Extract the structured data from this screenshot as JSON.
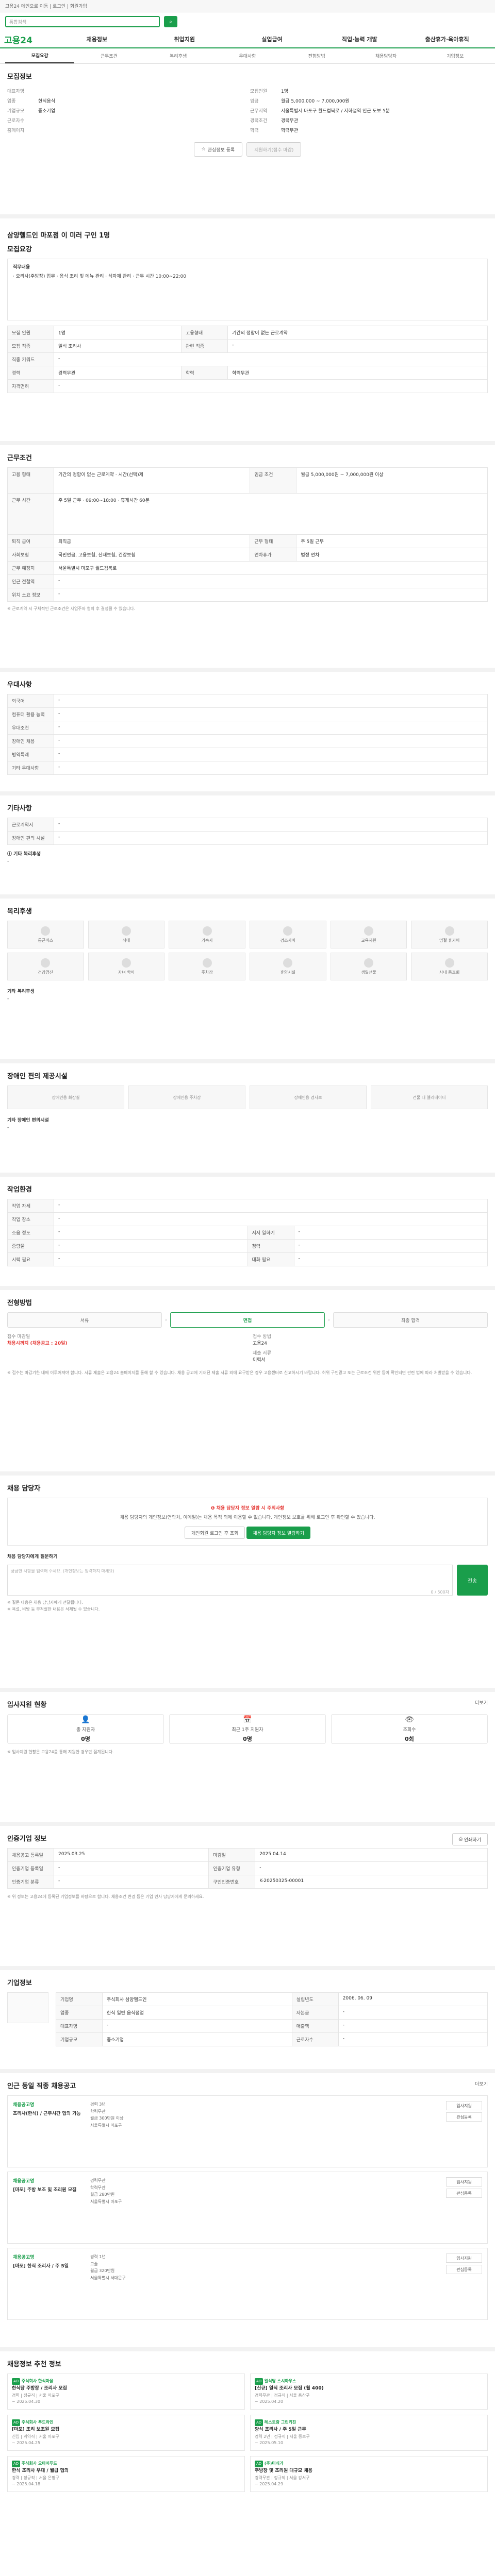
{
  "topbar": {
    "text": "고용24 메인으로 이동 | 로그인 | 회원가입"
  },
  "search": {
    "placeholder": "통합검색"
  },
  "gnb": {
    "logo": "고용24",
    "items": [
      "채용정보",
      "취업지원",
      "실업급여",
      "직업·능력 개발",
      "출산휴가·육아휴직"
    ]
  },
  "tabs": [
    "모집요강",
    "근무조건",
    "복리후생",
    "우대사항",
    "전형방법",
    "채용담당자",
    "기업정보"
  ],
  "company": {
    "title": "모집정보",
    "left": [
      {
        "k": "대표자명",
        "v": ""
      },
      {
        "k": "업종",
        "v": "한식음식"
      },
      {
        "k": "기업규모",
        "v": "중소기업"
      },
      {
        "k": "근로자수",
        "v": ""
      },
      {
        "k": "홈페이지",
        "v": ""
      }
    ],
    "right": [
      {
        "k": "모집인원",
        "v": "1명"
      },
      {
        "k": "임금",
        "v": "월급 5,000,000 ~ 7,000,000원"
      },
      {
        "k": "근무지역",
        "v": "서울특별시 마포구 월드컵북로 / 지하철역 인근 도보 5분"
      },
      {
        "k": "경력조건",
        "v": "경력무관"
      },
      {
        "k": "학력",
        "v": "학력무관"
      }
    ],
    "scrap_label": "관심정보 등록",
    "apply_label": "지원하기(접수 마감)"
  },
  "job": {
    "heading": "삼양헬드인 마포점 이 미러 구인 1명",
    "section_title": "모집요강",
    "desc_title": "직무내용",
    "desc": "· 요리사(주방장) 업무 · 음식 조리 및 메뉴 관리 · 식자재 관리 · 근무 시간 10:00~22:00",
    "table": [
      {
        "k": "모집 인원",
        "v": "1명",
        "k2": "고용형태",
        "v2": "기간의 정함이 없는 근로계약"
      },
      {
        "k": "모집 직종",
        "v": "일식 조리사",
        "k2": "관련 직종",
        "v2": "-"
      },
      {
        "k": "직종 키워드",
        "v": "-",
        "k2": "",
        "v2": ""
      },
      {
        "k": "경력",
        "v": "경력무관",
        "k2": "학력",
        "v2": "학력무관"
      },
      {
        "k": "자격면허",
        "v": "-",
        "k2": "",
        "v2": ""
      }
    ]
  },
  "conditions": {
    "title": "근무조건",
    "table": [
      {
        "k": "고용 형태",
        "v": "기간의 정함이 없는 근로계약 · 시간(선택)제",
        "k2": "임금 조건",
        "v2": "월급 5,000,000원 ~ 7,000,000원 이상"
      },
      {
        "k": "근무 시간",
        "v": "주 5일 근무 · 09:00~18:00 · 휴게시간 60분",
        "k2": "",
        "v2": ""
      },
      {
        "k": "퇴직 급여",
        "v": "퇴직금",
        "k2": "근무 형태",
        "v2": "주 5일 근무"
      },
      {
        "k": "사회보험",
        "v": "국민연금, 고용보험, 산재보험, 건강보험",
        "k2": "연차휴가",
        "v2": "법정 연차"
      },
      {
        "k": "근무 예정지",
        "v": "서울특별시 마포구 월드컵북로",
        "k2": "",
        "v2": ""
      },
      {
        "k": "인근 전철역",
        "v": "-",
        "k2": "",
        "v2": ""
      },
      {
        "k": "위치 소요 정보",
        "v": "-",
        "k2": "",
        "v2": ""
      }
    ],
    "note": "※ 근로계약 시 구체적인 근로조건은 사업주와 협의 후 결정될 수 있습니다."
  },
  "prefer": {
    "title": "우대사항",
    "rows": [
      {
        "k": "외국어",
        "v": "-"
      },
      {
        "k": "컴퓨터 활용 능력",
        "v": "-"
      },
      {
        "k": "우대조건",
        "v": "-"
      },
      {
        "k": "장애인 채용",
        "v": "-"
      },
      {
        "k": "병역특례",
        "v": "-"
      },
      {
        "k": "기타 우대사항",
        "v": "-"
      }
    ]
  },
  "etc": {
    "title": "기타사항",
    "rows": [
      {
        "k": "근로계약서",
        "v": "-"
      },
      {
        "k": "장애인 편의 시설",
        "v": "-"
      }
    ],
    "sub_title": "ⓘ 기타 복리후생",
    "sub_val": "-"
  },
  "welfare": {
    "title": "복리후생",
    "cards": [
      "통근버스",
      "식대",
      "기숙사",
      "경조사비",
      "교육지원",
      "명절 휴가비",
      "건강검진",
      "자녀 학비",
      "주차장",
      "휴양시설",
      "생일선물",
      "사내 동호회"
    ],
    "sub_title": "기타 복리후생",
    "sub_val": "-"
  },
  "disabled": {
    "title": "장애인 편의 제공시설",
    "cards": [
      "장애인용 화장실",
      "장애인용 주차장",
      "장애인용 경사로",
      "건물 내 엘리베이터"
    ],
    "sub_title": "기타 장애인 편의시설",
    "sub_val": "-"
  },
  "workenv": {
    "title": "작업환경",
    "rows": [
      {
        "k": "작업 자세",
        "v": "-",
        "k2": "",
        "v2": ""
      },
      {
        "k": "작업 장소",
        "v": "-",
        "k2": "",
        "v2": ""
      },
      {
        "k": "소음 정도",
        "v": "-",
        "k2": "서서 일하기",
        "v2": "-"
      },
      {
        "k": "중량물",
        "v": "-",
        "k2": "청력",
        "v2": "-"
      },
      {
        "k": "시력 필요",
        "v": "-",
        "k2": "대화 필요",
        "v2": "-"
      }
    ]
  },
  "selection": {
    "title": "전형방법",
    "steps": [
      "서류",
      "면접",
      "최종 합격"
    ],
    "deadline_k": "접수 마감일",
    "deadline_v": "채용시까지 (채용공고 : 20일)",
    "method_k": "접수 방법",
    "method_v": "고용24",
    "docs_k": "제출 서류",
    "docs_v": "이력서",
    "notice": "※ 접수는 마감기한 내에 이루어져야 합니다. 서류 제출은 고용24 홈페이지를 통해 할 수 있습니다. 채용 공고에 기재된 제출 서류 외에 요구받은 경우 고용센터로 신고하시기 바랍니다. 허위 구인광고 또는 근로조건 위반 등이 확인되면 관련 법에 따라 처벌받을 수 있습니다."
  },
  "manager": {
    "title": "채용 담당자",
    "warn_title": "❶ 채용 담당자 정보 열람 시 주의사항",
    "warn_text": "채용 담당자의 개인정보(연락처, 이메일)는 채용 목적 외에 이용할 수 없습니다. 개인정보 보호를 위해 로그인 후 확인할 수 있습니다.",
    "login_label": "개인회원 로그인 후 조회",
    "ask_label": "채용 담당자 정보 열람하기",
    "qa_title": "채용 담당자에게 질문하기",
    "qa_placeholder": "궁금한 사항을 입력해 주세요. (개인정보는 입력하지 마세요)",
    "qa_count": "0 / 500자",
    "qa_btn": "전송",
    "qa_notes": [
      "※ 질문 내용은 채용 담당자에게 전달됩니다.",
      "※ 욕설, 비방 등 부적절한 내용은 삭제될 수 있습니다."
    ]
  },
  "stats": {
    "title": "입사지원 현황",
    "more": "더보기",
    "items": [
      {
        "label": "총 지원자",
        "val": "0명"
      },
      {
        "label": "최근 1주 지원자",
        "val": "0명"
      },
      {
        "label": "조회수",
        "val": "0회"
      }
    ],
    "note": "※ 입사지원 현황은 고용24를 통해 지원한 경우만 집계됩니다."
  },
  "info": {
    "title": "인증기업 정보",
    "print": "인쇄하기",
    "rows": [
      {
        "k": "채용공고 등록일",
        "v": "2025.03.25",
        "k2": "마감일",
        "v2": "2025.04.14"
      },
      {
        "k": "인증기업 등록일",
        "v": "-",
        "k2": "인증기업 유형",
        "v2": "-"
      },
      {
        "k": "인증기업 분류",
        "v": "-",
        "k2": "구인인증번호",
        "v2": "K-20250325-00001"
      }
    ],
    "notice": "※ 위 정보는 고용24에 등록된 기업정보를 바탕으로 합니다. 채용조건 변경 등은 기업 인사 담당자에게 문의하세요."
  },
  "company_info": {
    "title": "기업정보",
    "rows": [
      {
        "k": "기업명",
        "v": "주식회사 삼양헬드인",
        "k2": "설립년도",
        "v2": "2006. 06. 09"
      },
      {
        "k": "업종",
        "v": "한식 일반 음식점업",
        "k2": "자본금",
        "v2": "-"
      },
      {
        "k": "대표자명",
        "v": "-",
        "k2": "매출액",
        "v2": "-"
      },
      {
        "k": "기업규모",
        "v": "중소기업",
        "k2": "근로자수",
        "v2": "-"
      }
    ]
  },
  "related": {
    "title": "인근 동일 직종 채용공고",
    "more": "더보기",
    "jobs": [
      {
        "company": "채용공고명",
        "title": "조리사(한식) / 근무시간 협의 가능",
        "d1": "경력 3년",
        "d2": "학력무관",
        "d3": "월급 300만원 이상",
        "d4": "서울특별시 마포구"
      },
      {
        "company": "채용공고명",
        "title": "[마포] 주방 보조 및 조리원 모집",
        "d1": "경력무관",
        "d2": "학력무관",
        "d3": "월급 280만원",
        "d4": "서울특별시 마포구"
      },
      {
        "company": "채용공고명",
        "title": "[마포] 한식 조리사 / 주 5일",
        "d1": "경력 1년",
        "d2": "고졸",
        "d3": "월급 320만원",
        "d4": "서울특별시 서대문구"
      }
    ],
    "btn1": "입사지원",
    "btn2": "관심등록"
  },
  "ads": {
    "title": "채용정보 추천 정보",
    "items": [
      {
        "co": "주식회사 한식마을",
        "title": "한식당 주방장 / 조리사 모집",
        "d": "경력 | 정규직 | 서울 마포구",
        "date": "~ 2025.04.30"
      },
      {
        "co": "일식당 스시하우스",
        "title": "[신규] 일식 조리사 모집 (월 400)",
        "d": "경력무관 | 정규직 | 서울 용산구",
        "date": "~ 2025.04.20"
      },
      {
        "co": "주식회사 푸드라인",
        "title": "[마포] 조리 보조원 모집",
        "d": "신입 | 계약직 | 서울 마포구",
        "date": "~ 2025.04.25"
      },
      {
        "co": "레스토랑 그린키친",
        "title": "양식 조리사 / 주 5일 근무",
        "d": "경력 2년 | 정규직 | 서울 종로구",
        "date": "~ 2025.05.10"
      },
      {
        "co": "주식회사 오마이푸드",
        "title": "한식 조리사 우대 / 월급 협의",
        "d": "경력 | 정규직 | 서울 은평구",
        "date": "~ 2025.04.18"
      },
      {
        "co": "(주)미식가",
        "title": "주방장 및 조리원 대규모 채용",
        "d": "경력무관 | 정규직 | 서울 강서구",
        "date": "~ 2025.04.29"
      }
    ]
  }
}
